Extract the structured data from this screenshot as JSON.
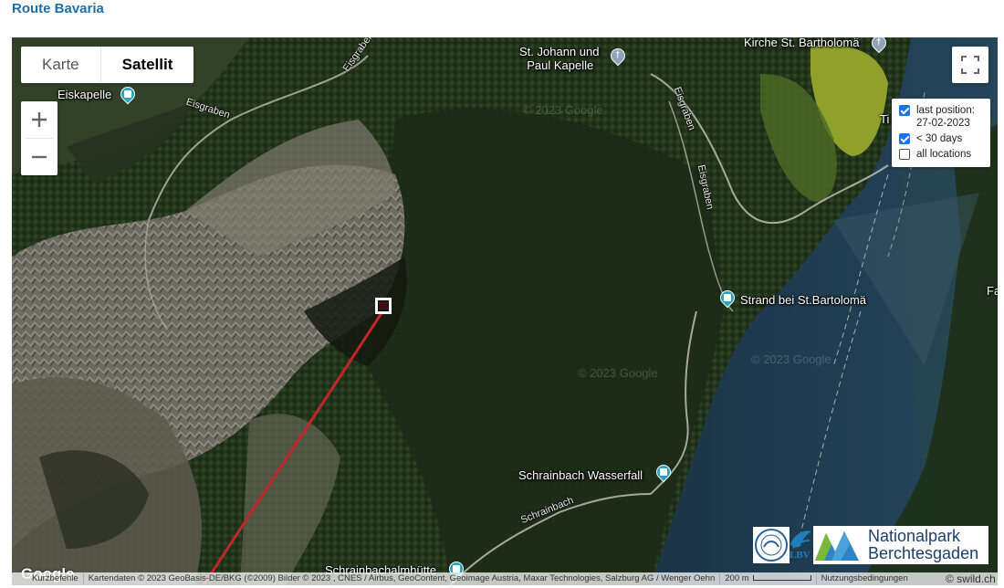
{
  "page": {
    "title": "Route Bavaria"
  },
  "map": {
    "maptype": {
      "map_label": "Karte",
      "satellite_label": "Satellit",
      "active": "satellite"
    },
    "zoom": {
      "in_label": "+",
      "out_label": "−"
    },
    "legend": {
      "items": [
        {
          "label_line1": "last position:",
          "label_line2": "27-02-2023",
          "checked": true
        },
        {
          "label_line1": "< 30 days",
          "label_line2": "",
          "checked": true
        },
        {
          "label_line1": "all locations",
          "label_line2": "",
          "checked": false
        }
      ]
    },
    "places": {
      "eiskapelle": "Eiskapelle",
      "st_johann_1": "St. Johann und",
      "st_johann_2": "Paul Kapelle",
      "kirche": "Kirche St. Bartholomä",
      "strand": "Strand bei St.Bartolomä",
      "wasserfall": "Schrainbach Wasserfall",
      "huette": "Schrainbachalmhütte"
    },
    "rivers": {
      "eisgraben_1": "Eisgraben",
      "eisgraben_2": "Eisgraben",
      "eisgraben_3": "Eisgraben",
      "eisgraben_4": "Eisgraben",
      "schrainbach": "Schrainbach"
    },
    "watermarks": [
      "© 2023 Google",
      "© 2023 Google",
      "© 2023 Google"
    ],
    "logos": {
      "lbv": "LBV",
      "np_line1": "Nationalpark",
      "np_line2": "Berchtesgaden"
    },
    "google": "Google",
    "attribution": {
      "shortcuts": "Kurzbefehle",
      "data": "Kartendaten © 2023 GeoBasis-DE/BKG (©2009) Bilder © 2023 , CNES / Airbus, GeoContent, Geoimage Austria, Maxar Technologies, Salzburg AG / Wenger Oehn",
      "scale": "200 m",
      "terms": "Nutzungsbedingungen"
    },
    "edge_labels": {
      "right_top": "Ti",
      "right_mid": "Fa"
    },
    "colors": {
      "lake": "#1e3a4f",
      "meadow": "#8fa12a",
      "route": "#c0262a"
    }
  },
  "credit": "© swild.ch"
}
